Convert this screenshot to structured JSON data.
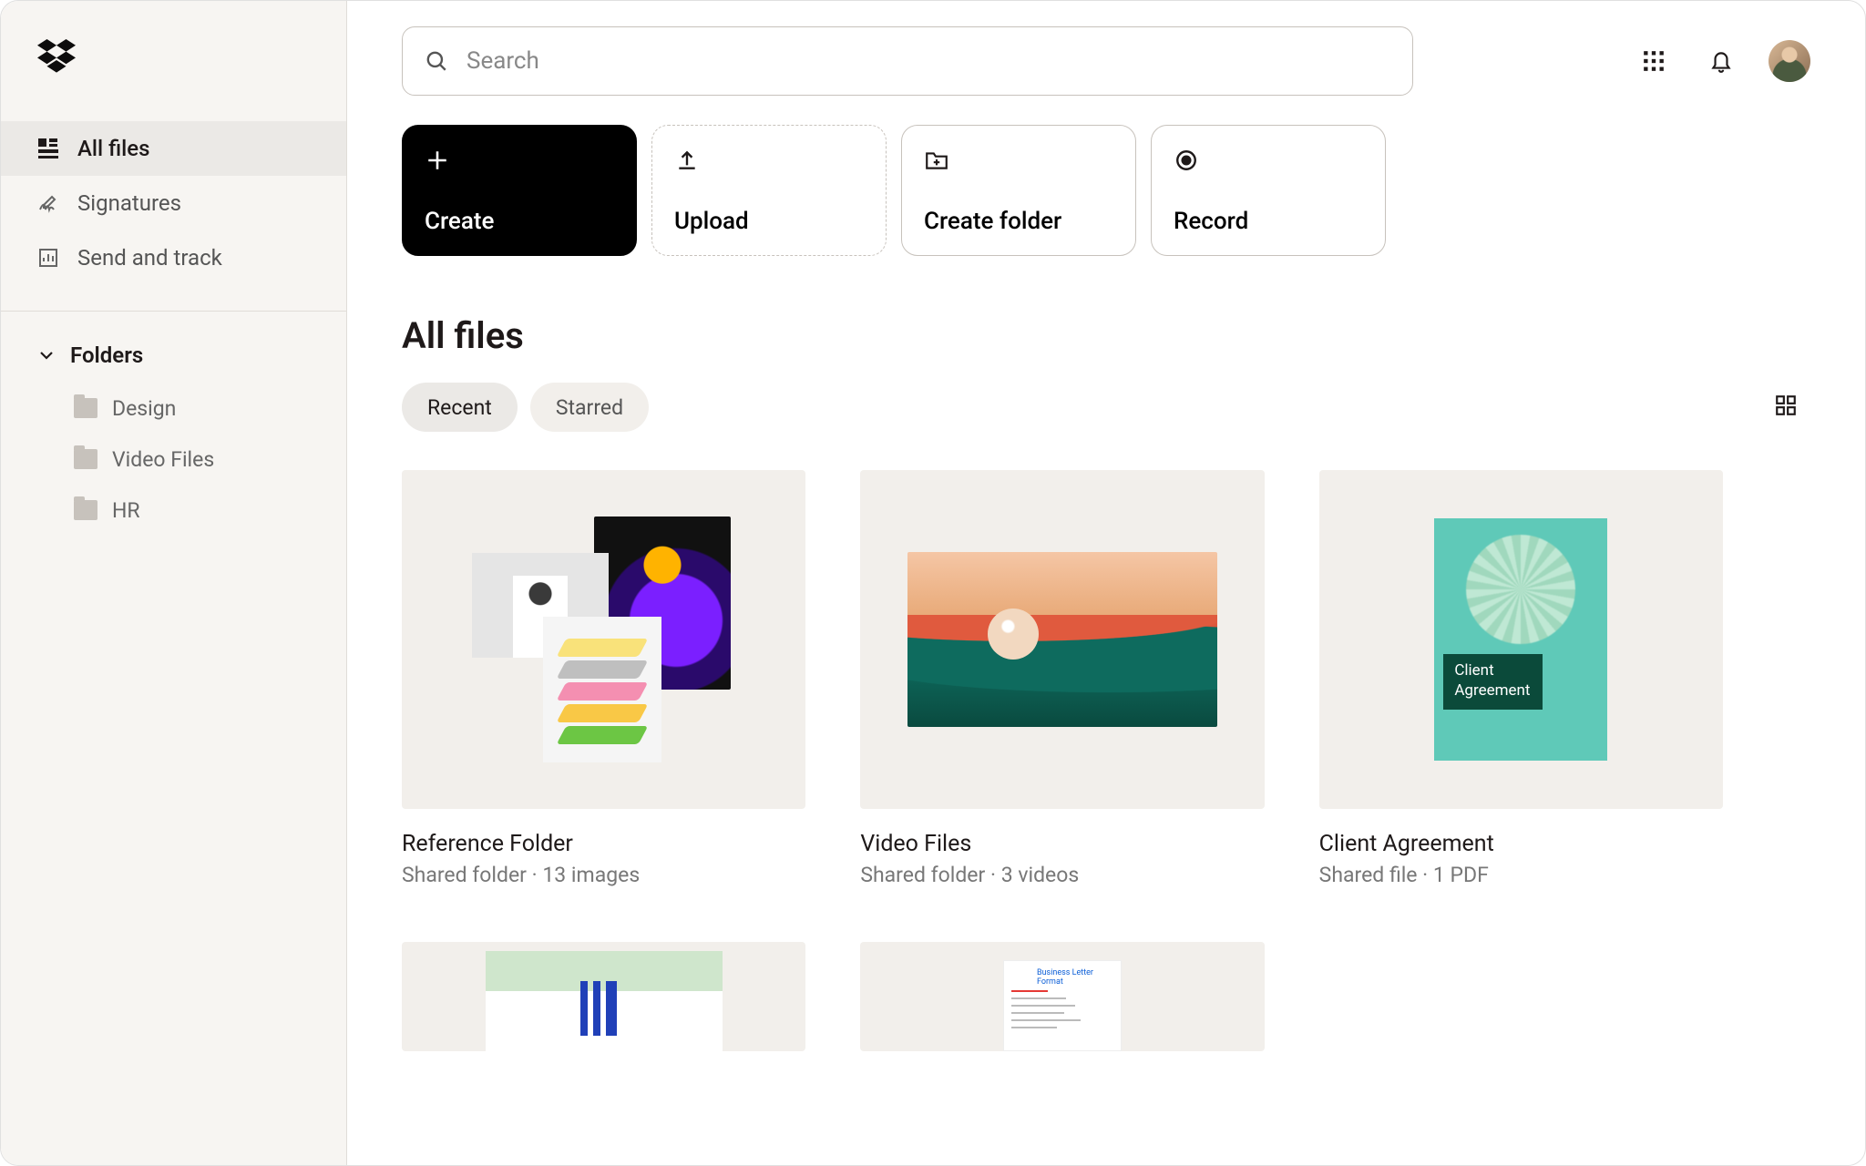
{
  "search": {
    "placeholder": "Search"
  },
  "sidebar": {
    "items": [
      {
        "label": "All files"
      },
      {
        "label": "Signatures"
      },
      {
        "label": "Send and track"
      }
    ],
    "folders_label": "Folders",
    "folders": [
      {
        "label": "Design"
      },
      {
        "label": "Video Files"
      },
      {
        "label": "HR"
      }
    ]
  },
  "actions": {
    "create": "Create",
    "upload": "Upload",
    "create_folder": "Create folder",
    "record": "Record"
  },
  "page_title": "All files",
  "filters": {
    "recent": "Recent",
    "starred": "Starred"
  },
  "cards": [
    {
      "title": "Reference Folder",
      "subtitle": "Shared folder · 13 images"
    },
    {
      "title": "Video Files",
      "subtitle": "Shared folder · 3 videos"
    },
    {
      "title": "Client Agreement",
      "subtitle": "Shared file · 1 PDF",
      "overlay_line1": "Client",
      "overlay_line2": "Agreement"
    }
  ],
  "row2_doc_heading": "Business Letter Format"
}
